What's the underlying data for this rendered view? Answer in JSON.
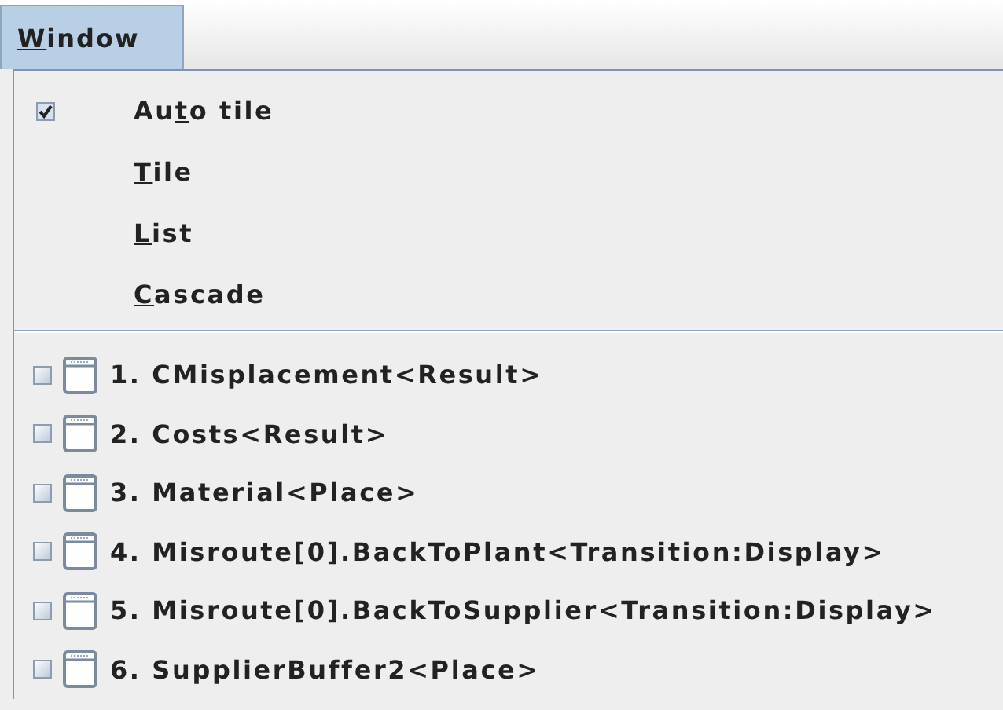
{
  "menu_bar": {
    "menus": [
      {
        "label": {
          "underlined": "W",
          "after": "indow"
        },
        "selected": true
      }
    ]
  },
  "menu": {
    "commands": [
      {
        "kind": "check",
        "label": {
          "before": "Au",
          "underlined": "t",
          "after": "o tile"
        },
        "checked": true
      },
      {
        "kind": "action",
        "label": {
          "underlined": "T",
          "after": "ile"
        }
      },
      {
        "kind": "action",
        "label": {
          "underlined": "L",
          "after": "ist"
        }
      },
      {
        "kind": "action",
        "label": {
          "underlined": "C",
          "after": "ascade"
        }
      }
    ],
    "windows": [
      {
        "label": "1. CMisplacement<Result>",
        "checked": false
      },
      {
        "label": "2. Costs<Result>",
        "checked": false
      },
      {
        "label": "3. Material<Place>",
        "checked": false
      },
      {
        "label": "4. Misroute[0].BackToPlant<Transition:Display>",
        "checked": false
      },
      {
        "label": "5. Misroute[0].BackToSupplier<Transition:Display>",
        "checked": false
      },
      {
        "label": "6. SupplierBuffer2<Place>",
        "checked": false
      }
    ]
  }
}
